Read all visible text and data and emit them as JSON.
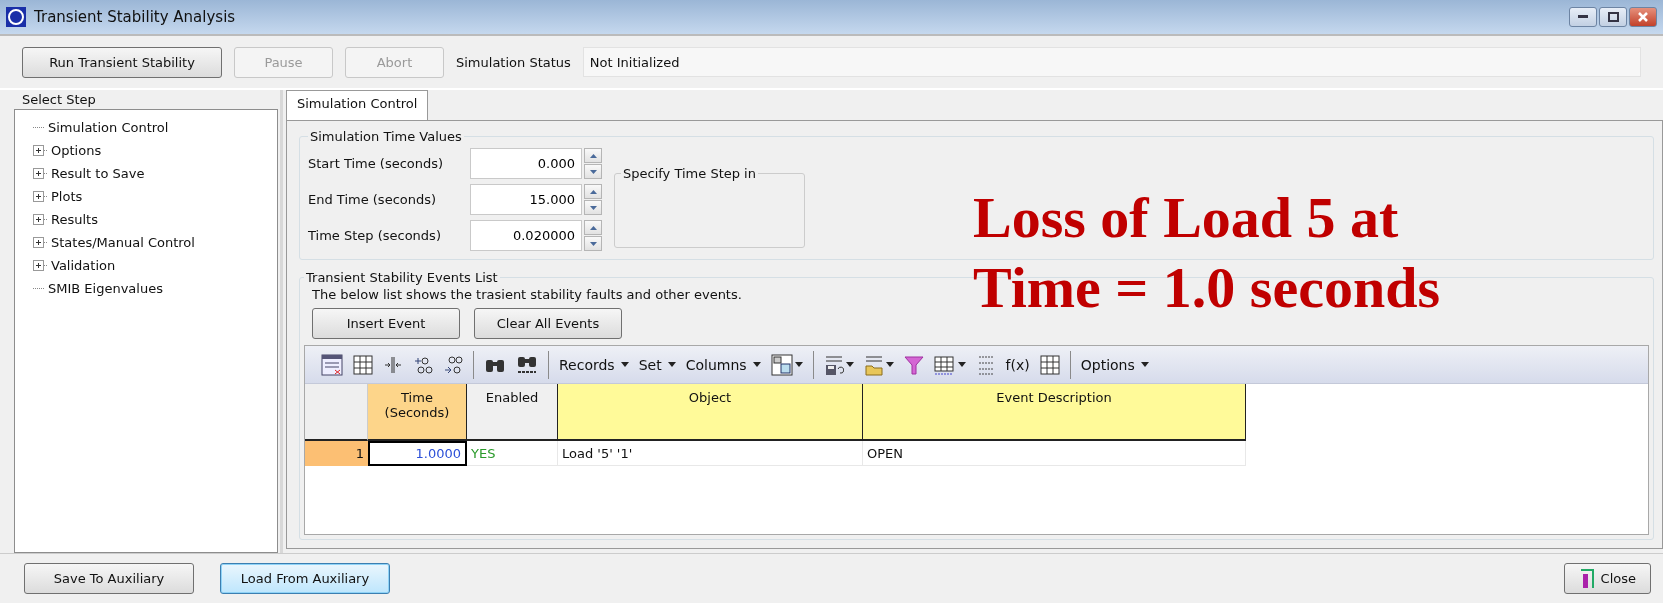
{
  "window": {
    "title": "Transient Stability Analysis"
  },
  "actions": [
    {
      "label": "Run Transient Stability",
      "disabled": false
    },
    {
      "label": "Pause",
      "disabled": true
    },
    {
      "label": "Abort",
      "disabled": true
    }
  ],
  "status": {
    "label": "Simulation Status",
    "value": "Not Initialized"
  },
  "sidebar": {
    "title": "Select Step",
    "items": [
      {
        "label": "Simulation Control",
        "kind": "leaf"
      },
      {
        "label": "Options",
        "kind": "group"
      },
      {
        "label": "Result to Save",
        "kind": "group"
      },
      {
        "label": "Plots",
        "kind": "group"
      },
      {
        "label": "Results",
        "kind": "group"
      },
      {
        "label": "States/Manual Control",
        "kind": "group"
      },
      {
        "label": "Validation",
        "kind": "group"
      },
      {
        "label": "SMIB Eigenvalues",
        "kind": "leaf"
      }
    ]
  },
  "tabs": [
    {
      "label": "Simulation Control",
      "selected": true
    }
  ],
  "time_values": {
    "title": "Simulation Time Values",
    "fields": [
      {
        "label": "Start Time (seconds)",
        "value": "0.000"
      },
      {
        "label": "End Time (seconds)",
        "value": "15.000"
      },
      {
        "label": "Time Step (seconds)",
        "value": "0.020000"
      }
    ],
    "step_group": {
      "title": "Specify Time Step in"
    }
  },
  "events": {
    "title": "Transient Stability Events List",
    "description": "The below list shows the trasient stability faults and other events.",
    "buttons": [
      "Insert Event",
      "Clear All Events"
    ],
    "toolbar": [
      {
        "kind": "icon"
      },
      {
        "kind": "icon"
      },
      {
        "kind": "icon"
      },
      {
        "kind": "icon"
      },
      {
        "kind": "icon"
      },
      {
        "kind": "sep"
      },
      {
        "kind": "icon"
      },
      {
        "kind": "icon"
      },
      {
        "kind": "sep"
      },
      {
        "kind": "menu",
        "label": "Records"
      },
      {
        "kind": "menu",
        "label": "Set"
      },
      {
        "kind": "menu",
        "label": "Columns"
      },
      {
        "kind": "icon",
        "caret": true
      },
      {
        "kind": "sep"
      },
      {
        "kind": "icon",
        "caret": true
      },
      {
        "kind": "icon",
        "caret": true
      },
      {
        "kind": "icon"
      },
      {
        "kind": "icon",
        "caret": true
      },
      {
        "kind": "icon"
      },
      {
        "kind": "text",
        "label": "f(x)"
      },
      {
        "kind": "icon"
      },
      {
        "kind": "sep"
      },
      {
        "kind": "menu",
        "label": "Options"
      }
    ],
    "table": {
      "columns": [
        {
          "label": "Time (Seconds)",
          "color": "#fdd58a"
        },
        {
          "label": "Enabled",
          "color": "#f0f0f0"
        },
        {
          "label": "Object",
          "color": "#fffa99"
        },
        {
          "label": "Event Description",
          "color": "#fffa99"
        }
      ],
      "rows": [
        {
          "number": "1",
          "selected": true,
          "cells": [
            "1.0000",
            "YES",
            "Load '5' '1'",
            "OPEN"
          ]
        }
      ]
    }
  },
  "annotation": [
    "Loss of Load 5 at",
    "Time = 1.0 seconds"
  ],
  "footer": {
    "buttons": [
      {
        "label": "Save To Auxiliary",
        "focused": false
      },
      {
        "label": "Load From Auxiliary",
        "focused": true
      }
    ],
    "close": "Close"
  }
}
